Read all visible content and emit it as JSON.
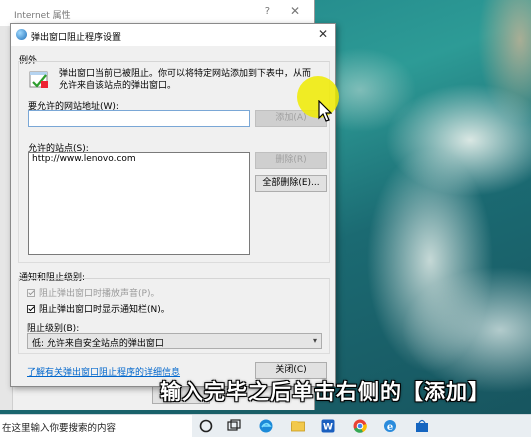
{
  "background_window": {
    "title": "Internet 属性",
    "help": "?",
    "close": "✕"
  },
  "dialog": {
    "title": "弹出窗口阻止程序设置",
    "close": "✕",
    "exceptions_label": "例外",
    "description": "弹出窗口当前已被阻止。你可以将特定网站添加到下表中，从而允许来自该站点的弹出窗口。",
    "address_label": "要允许的网站地址(W):",
    "address_value": "",
    "add_button": "添加(A)",
    "allowed_label": "允许的站点(S):",
    "allowed_sites": [
      "http://www.lenovo.com"
    ],
    "remove_button": "删除(R)",
    "remove_all_button": "全部删除(E)...",
    "notify_label": "通知和阻止级别:",
    "play_sound": {
      "label": "阻止弹出窗口时播放声音(P)。",
      "checked": true,
      "enabled": false
    },
    "show_bar": {
      "label": "阻止弹出窗口时显示通知栏(N)。",
      "checked": true,
      "enabled": true
    },
    "block_level_label": "阻止级别(B):",
    "block_level_value": "低: 允许来自安全站点的弹出窗口",
    "learn_more_link": "了解有关弹出窗口阻止程序的详细信息",
    "close_button": "关闭(C)"
  },
  "caption": "输入完毕之后单击右侧的【添加】",
  "taskbar": {
    "search_placeholder": "在这里输入你要搜索的内容",
    "icons": [
      "cortana-icon",
      "task-view-icon",
      "edge-icon",
      "file-explorer-icon",
      "store-icon",
      "wps-icon",
      "chrome-icon",
      "ie-icon"
    ]
  },
  "colors": {
    "highlight": "#f0eb00",
    "link": "#0066cc",
    "accent_border": "#7aa7d6"
  }
}
